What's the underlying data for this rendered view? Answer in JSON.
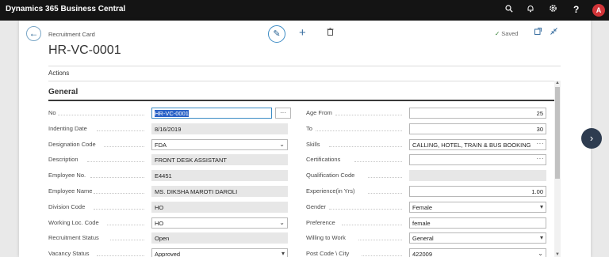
{
  "app": {
    "title": "Dynamics 365 Business Central",
    "avatar_initial": "A"
  },
  "topbar_icons": [
    "search-icon",
    "bell-icon",
    "gear-icon",
    "help-icon"
  ],
  "page": {
    "breadcrumb": "Recruitment Card",
    "title": "HR-VC-0001",
    "saved_status": "Saved",
    "actions_label": "Actions"
  },
  "section": {
    "title": "General"
  },
  "left_fields": [
    {
      "label": "No",
      "value": "HR-VC-0001",
      "kind": "edit-selected"
    },
    {
      "label": "Indenting Date",
      "value": "8/16/2019",
      "kind": "readonly"
    },
    {
      "label": "Designation Code",
      "value": "FDA",
      "kind": "dropdown"
    },
    {
      "label": "Description",
      "value": "FRONT DESK ASSISTANT",
      "kind": "readonly"
    },
    {
      "label": "Employee No.",
      "value": "E4451",
      "kind": "readonly"
    },
    {
      "label": "Employee Name",
      "value": "MS. DIKSHA MAROTI DAROLI",
      "kind": "readonly"
    },
    {
      "label": "Division Code",
      "value": "HO",
      "kind": "readonly"
    },
    {
      "label": "Working Loc. Code",
      "value": "HO",
      "kind": "dropdown"
    },
    {
      "label": "Recruitment Status",
      "value": "Open",
      "kind": "readonly"
    },
    {
      "label": "Vacancy Status",
      "value": "Approved",
      "kind": "select"
    }
  ],
  "right_fields": [
    {
      "label": "Age From",
      "value": "25",
      "kind": "number"
    },
    {
      "label": "To",
      "value": "30",
      "kind": "number"
    },
    {
      "label": "Skills",
      "value": "CALLING, HOTEL, TRAIN & BUS BOOKING",
      "kind": "lookup"
    },
    {
      "label": "Certifications",
      "value": "",
      "kind": "lookup"
    },
    {
      "label": "Qualification Code",
      "value": "",
      "kind": "readonly"
    },
    {
      "label": "Experience(in Yrs)",
      "value": "1.00",
      "kind": "number"
    },
    {
      "label": "Gender",
      "value": "Female",
      "kind": "select"
    },
    {
      "label": "Preference",
      "value": "female",
      "kind": "text"
    },
    {
      "label": "Willing to Work",
      "value": "General",
      "kind": "select"
    },
    {
      "label": "Post Code \\ City",
      "value": "422009",
      "kind": "dropdown"
    }
  ]
}
